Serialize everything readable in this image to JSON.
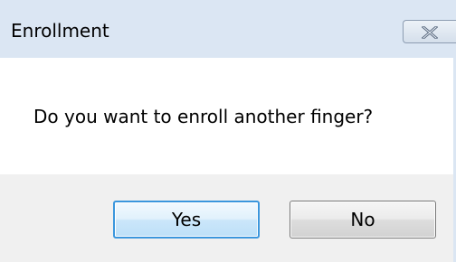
{
  "window": {
    "title": "Enrollment",
    "close_icon": "close-icon"
  },
  "message": {
    "text": "Do you want to enroll another finger?"
  },
  "buttons": {
    "yes_label": "Yes",
    "no_label": "No"
  },
  "colors": {
    "titlebar": "#dbe6f3",
    "footer": "#f0f0f0",
    "default_button_border": "#3a96dd"
  }
}
